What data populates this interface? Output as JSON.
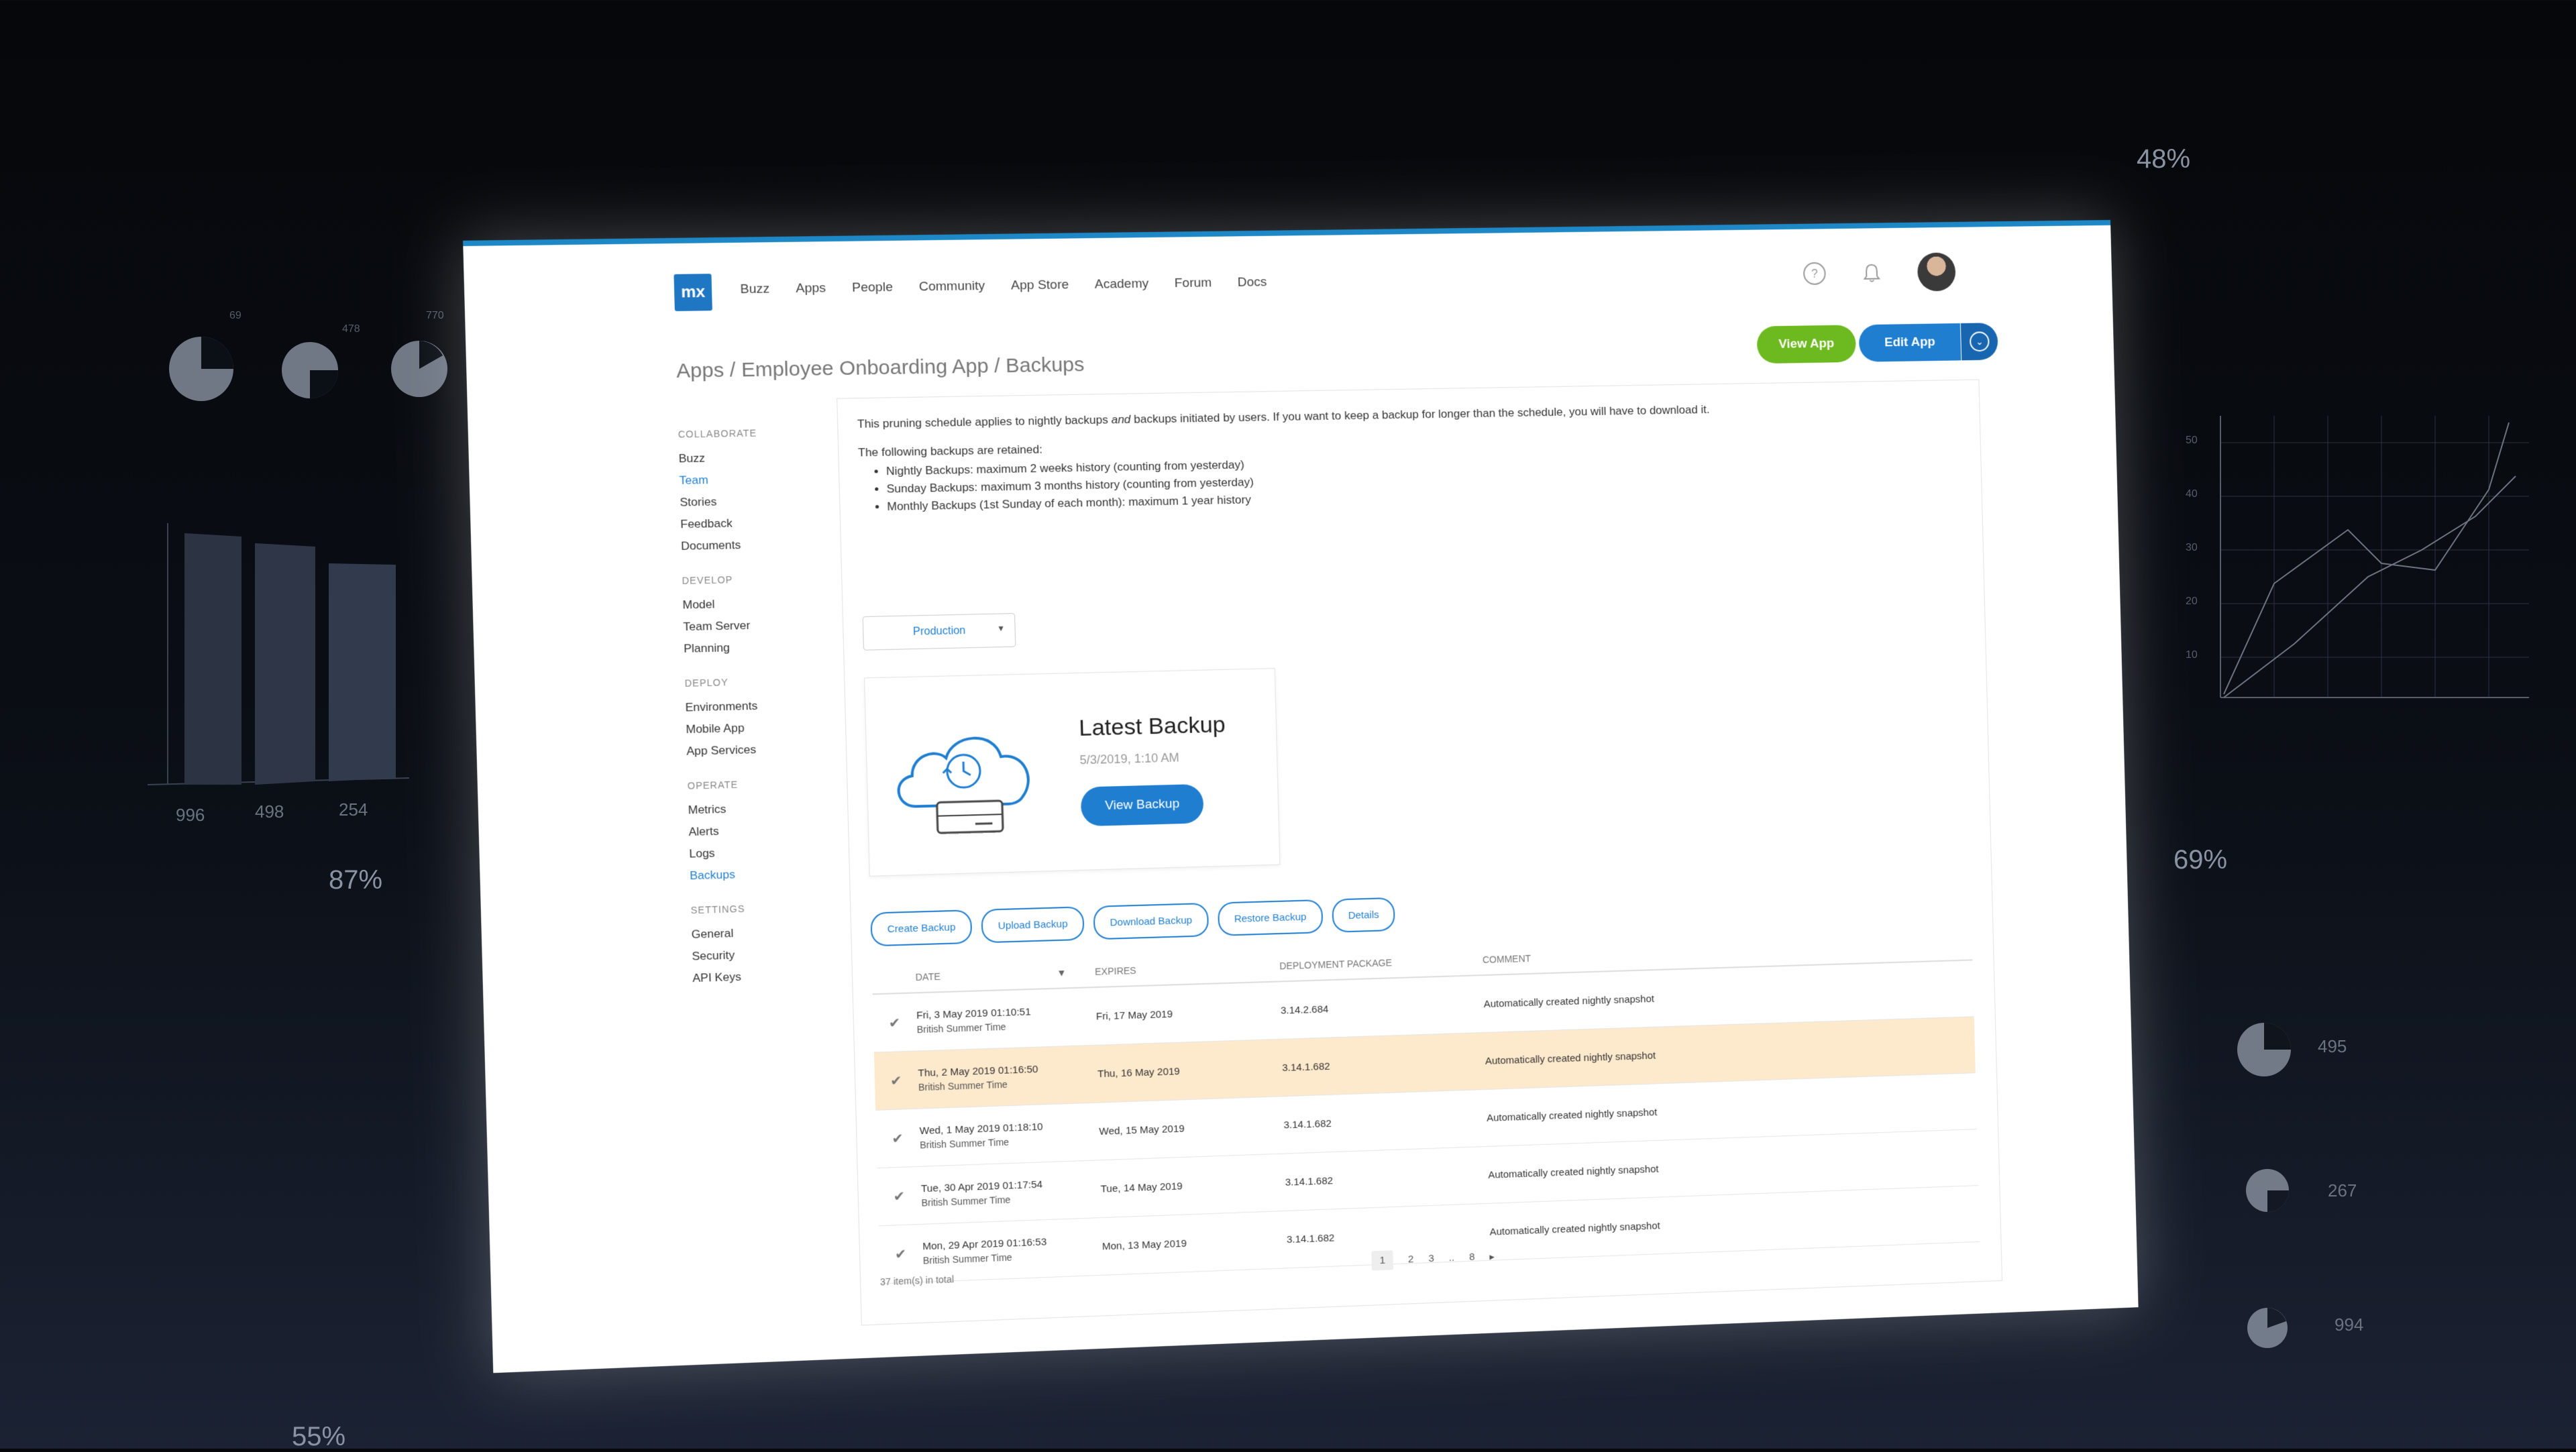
{
  "background": {
    "percents": [
      "48%",
      "69%",
      "87%",
      "55%"
    ],
    "pie_labels_top": [
      "69",
      "478",
      "770"
    ],
    "bar_labels": [
      "996",
      "498",
      "254"
    ],
    "pie_labels_right": [
      "495",
      "267",
      "994"
    ],
    "line_chart_y_ticks": [
      "50",
      "40",
      "30",
      "20",
      "10"
    ]
  },
  "app": {
    "logo": "mx",
    "nav": [
      "Buzz",
      "Apps",
      "People",
      "Community",
      "App Store",
      "Academy",
      "Forum",
      "Docs"
    ],
    "help_icon": "?",
    "view_app": "View App",
    "edit_app": "Edit App",
    "breadcrumb": "Apps / Employee Onboarding App / Backups"
  },
  "sidebar": {
    "collaborate": {
      "title": "COLLABORATE",
      "items": [
        "Buzz",
        "Team",
        "Stories",
        "Feedback",
        "Documents"
      ]
    },
    "develop": {
      "title": "DEVELOP",
      "items": [
        "Model",
        "Team Server",
        "Planning"
      ]
    },
    "deploy": {
      "title": "DEPLOY",
      "items": [
        "Environments",
        "Mobile App",
        "App Services"
      ]
    },
    "operate": {
      "title": "OPERATE",
      "items": [
        "Metrics",
        "Alerts",
        "Logs",
        "Backups"
      ]
    },
    "settings": {
      "title": "SETTINGS",
      "items": [
        "General",
        "Security",
        "API Keys"
      ]
    }
  },
  "intro": {
    "p1_a": "This pruning schedule applies to nightly backups ",
    "p1_em": "and",
    "p1_b": " backups initiated by users. If you want to keep a backup for longer than the schedule, you will have to download it.",
    "p2": "The following backups are retained:",
    "bullets": [
      "Nightly Backups: maximum 2 weeks history (counting from yesterday)",
      "Sunday Backups: maximum 3 months history (counting from yesterday)",
      "Monthly Backups (1st Sunday of each month): maximum 1 year history"
    ]
  },
  "environment": "Production",
  "latest": {
    "title": "Latest Backup",
    "time": "5/3/2019, 1:10 AM",
    "button": "View Backup"
  },
  "actions": [
    "Create Backup",
    "Upload Backup",
    "Download Backup",
    "Restore Backup",
    "Details"
  ],
  "table": {
    "headers": {
      "date": "DATE",
      "expires": "EXPIRES",
      "package": "DEPLOYMENT PACKAGE",
      "comment": "COMMENT"
    },
    "rows": [
      {
        "date": "Fri, 3 May 2019 01:10:51",
        "tz": "British Summer Time",
        "expires": "Fri, 17 May 2019",
        "package": "3.14.2.684",
        "comment": "Automatically created nightly snapshot"
      },
      {
        "date": "Thu, 2 May 2019 01:16:50",
        "tz": "British Summer Time",
        "expires": "Thu, 16 May 2019",
        "package": "3.14.1.682",
        "comment": "Automatically created nightly snapshot"
      },
      {
        "date": "Wed, 1 May 2019 01:18:10",
        "tz": "British Summer Time",
        "expires": "Wed, 15 May 2019",
        "package": "3.14.1.682",
        "comment": "Automatically created nightly snapshot"
      },
      {
        "date": "Tue, 30 Apr 2019 01:17:54",
        "tz": "British Summer Time",
        "expires": "Tue, 14 May 2019",
        "package": "3.14.1.682",
        "comment": "Automatically created nightly snapshot"
      },
      {
        "date": "Mon, 29 Apr 2019 01:16:53",
        "tz": "British Summer Time",
        "expires": "Mon, 13 May 2019",
        "package": "3.14.1.682",
        "comment": "Automatically created nightly snapshot"
      }
    ],
    "total": "37 item(s) in total",
    "pages": [
      "1",
      "2",
      "3",
      "..",
      "8"
    ]
  }
}
